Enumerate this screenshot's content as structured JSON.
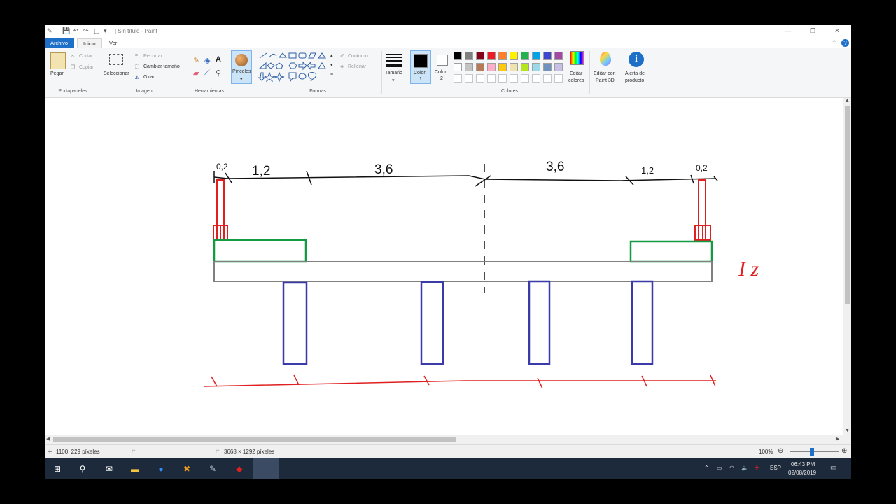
{
  "window": {
    "title": "| Sin título - Paint",
    "minimize": "—",
    "restore": "❐",
    "close": "✕"
  },
  "menu": {
    "tabs": [
      "Archivo",
      "Inicio",
      "Ver"
    ],
    "collapse": "⌃",
    "help": "?"
  },
  "ribbon": {
    "clipboard": {
      "paste": "Pegar",
      "cut": "Cortar",
      "copy": "Copiar",
      "group": "Portapapeles"
    },
    "image": {
      "select": "Seleccionar",
      "crop": "Recortar",
      "resize": "Cambiar tamaño",
      "rotate": "Girar",
      "group": "Imagen"
    },
    "tools": {
      "group": "Herramientas"
    },
    "brushes": {
      "label": "Pinceles"
    },
    "shapes": {
      "outline": "Contorno",
      "fill": "Rellenar",
      "group": "Formas"
    },
    "size": {
      "label": "Tamaño"
    },
    "color1": {
      "label": "Color",
      "num": "1"
    },
    "color2": {
      "label": "Color",
      "num": "2"
    },
    "colors": {
      "group": "Colores",
      "row1": [
        "#000000",
        "#7f7f7f",
        "#880015",
        "#ed1c24",
        "#ff7f27",
        "#fff200",
        "#22b14c",
        "#00a2e8",
        "#3f48cc",
        "#a349a4"
      ],
      "row2": [
        "#ffffff",
        "#c3c3c3",
        "#b97a57",
        "#ffaec9",
        "#ffc90e",
        "#efe4b0",
        "#b5e61d",
        "#99d9ea",
        "#7092be",
        "#c8bfe7"
      ]
    },
    "edit_colors": {
      "line1": "Editar",
      "line2": "colores"
    },
    "paint3d": {
      "line1": "Editar con",
      "line2": "Paint 3D"
    },
    "alert": {
      "line1": "Alerta de",
      "line2": "producto"
    }
  },
  "drawing": {
    "dim_labels": [
      "0,2",
      "1,2",
      "3,6",
      "3,6",
      "1,2",
      "0,2"
    ],
    "note": "I z",
    "colors": {
      "red": "#e02020",
      "green": "#139a43",
      "gray": "#808080",
      "blue": "#3a3aa8",
      "black": "#111111"
    }
  },
  "status": {
    "cursor_pos": "1100, 229 píxeles",
    "image_size": "3668 × 1292 píxeles",
    "zoom": "100%",
    "zoom_level_percent": 100
  },
  "taskbar": {
    "lang": "ESP",
    "time": "06:43 PM",
    "date": "02/08/2019"
  }
}
